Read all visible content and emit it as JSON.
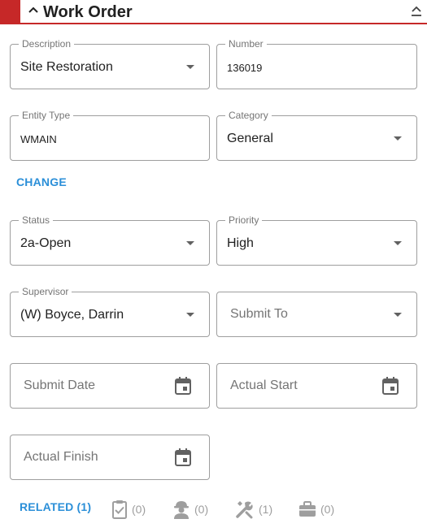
{
  "header": {
    "title": "Work Order"
  },
  "fields": {
    "description": {
      "label": "Description",
      "value": "Site Restoration"
    },
    "number": {
      "label": "Number",
      "value": "136019"
    },
    "entity_type": {
      "label": "Entity Type",
      "value": "WMAIN"
    },
    "category": {
      "label": "Category",
      "value": "General"
    },
    "status": {
      "label": "Status",
      "value": "2a-Open"
    },
    "priority": {
      "label": "Priority",
      "value": "High"
    },
    "supervisor": {
      "label": "Supervisor",
      "value": "(W) Boyce, Darrin"
    },
    "submit_to": {
      "placeholder": "Submit To"
    },
    "submit_date": {
      "placeholder": "Submit Date"
    },
    "actual_start": {
      "placeholder": "Actual Start"
    },
    "actual_finish": {
      "placeholder": "Actual Finish"
    }
  },
  "change_link": "CHANGE",
  "related": {
    "label": "RELATED (1)",
    "items": [
      {
        "icon": "clipboard-check-icon",
        "count": "(0)"
      },
      {
        "icon": "worker-icon",
        "count": "(0)"
      },
      {
        "icon": "tools-icon",
        "count": "(1)"
      },
      {
        "icon": "briefcase-icon",
        "count": "(0)"
      }
    ]
  },
  "colors": {
    "accent": "#c62828",
    "link": "#2b8fd8",
    "border": "#9e9e9e"
  }
}
